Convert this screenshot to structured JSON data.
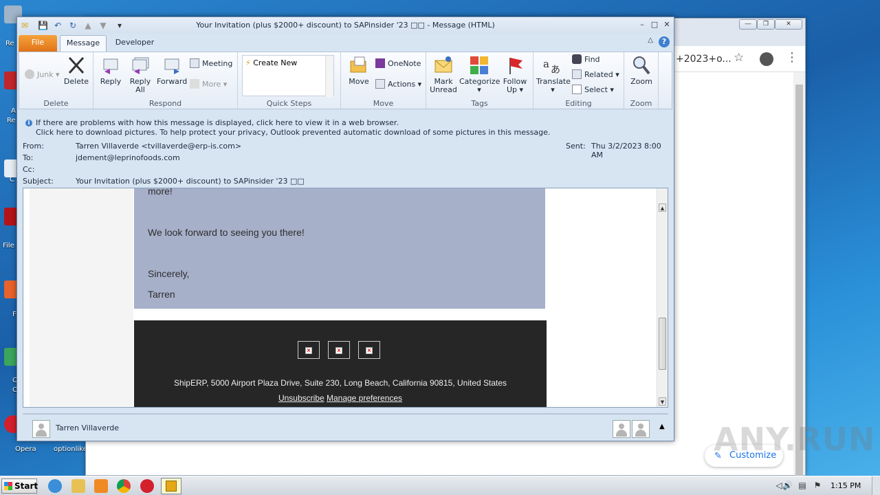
{
  "desktop": {
    "labels": [
      "Re",
      "A",
      "Re",
      "C",
      "File",
      "F",
      "C",
      "C",
      "Opera",
      "optionlike"
    ]
  },
  "chrome": {
    "url_fragment": "+2023+o...",
    "customize_label": "Customize",
    "customize_icon": "pencil-icon"
  },
  "watermark": "ANY.RUN",
  "outlook": {
    "title": "Your Invitation (plus $2000+ discount) to SAPinsider '23 □□  -  Message (HTML)",
    "tabs": {
      "file": "File",
      "message": "Message",
      "developer": "Developer"
    },
    "ribbon": {
      "delete_group": {
        "label": "Delete",
        "junk": "Junk",
        "delete": "Delete"
      },
      "respond_group": {
        "label": "Respond",
        "reply": "Reply",
        "reply_all_1": "Reply",
        "reply_all_2": "All",
        "forward": "Forward",
        "meeting": "Meeting",
        "more": "More"
      },
      "quick_steps_group": {
        "label": "Quick Steps",
        "create_new": "Create New"
      },
      "move_group": {
        "label": "Move",
        "move": "Move",
        "onenote": "OneNote",
        "actions": "Actions"
      },
      "tags_group": {
        "label": "Tags",
        "mark_unread_1": "Mark",
        "mark_unread_2": "Unread",
        "categorize": "Categorize",
        "follow_up_1": "Follow",
        "follow_up_2": "Up"
      },
      "editing_group": {
        "label": "Editing",
        "translate": "Translate",
        "find": "Find",
        "related": "Related",
        "select": "Select"
      },
      "zoom_group": {
        "label": "Zoom",
        "zoom": "Zoom"
      }
    },
    "infobar": {
      "line1": "If there are problems with how this message is displayed, click here to view it in a web browser.",
      "line2": "Click here to download pictures. To help protect your privacy, Outlook prevented automatic download of some pictures in this message."
    },
    "header": {
      "from_label": "From:",
      "from_value": "Tarren Villaverde <tvillaverde@erp-is.com>",
      "to_label": "To:",
      "to_value": "jdement@leprinofoods.com",
      "cc_label": "Cc:",
      "cc_value": "",
      "subject_label": "Subject:",
      "subject_value": "Your Invitation (plus $2000+ discount) to SAPinsider '23 □□",
      "sent_label": "Sent:",
      "sent_value": "Thu 3/2/2023 8:00 AM"
    },
    "body": {
      "line_more": "more!",
      "line_forward": "We look forward to seeing you there!",
      "line_sincerely": "Sincerely,",
      "line_name": "Tarren",
      "footer_address": "ShipERP, 5000 Airport Plaza Drive, Suite 230, Long Beach, California 90815, United States",
      "unsubscribe": "Unsubscribe",
      "manage_prefs": "Manage preferences",
      "broken_image_glyph": "×"
    },
    "people_pane": {
      "name": "Tarren Villaverde"
    }
  },
  "taskbar": {
    "start_label": "Start",
    "clock": "1:15 PM"
  }
}
